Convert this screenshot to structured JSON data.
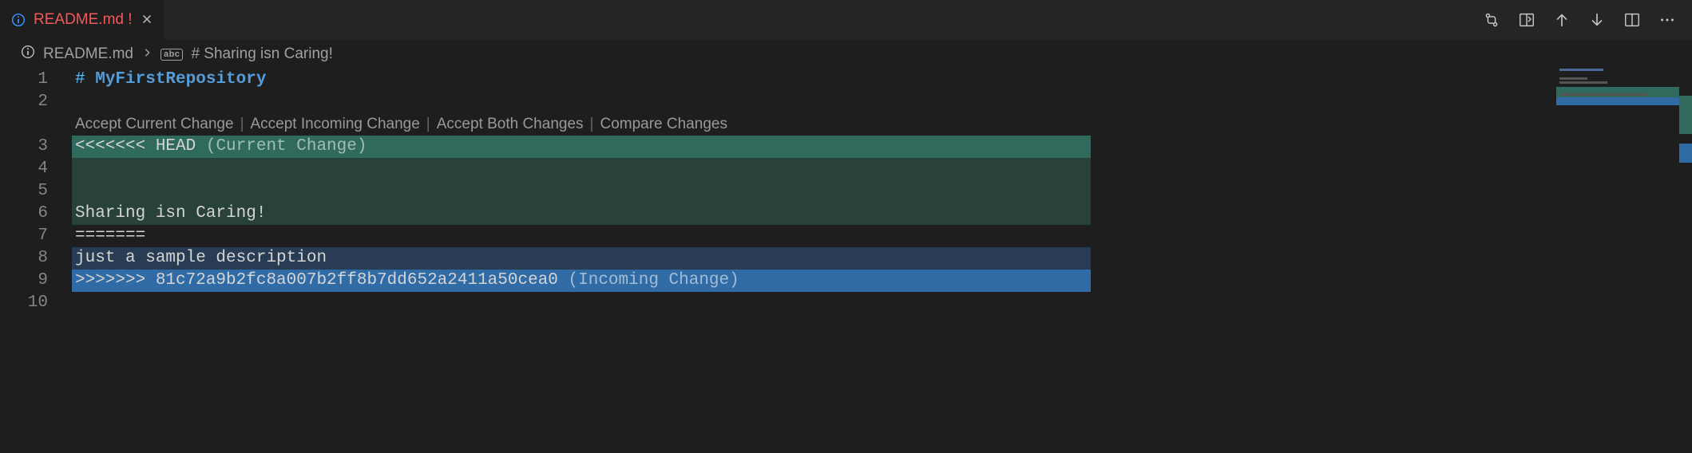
{
  "tab": {
    "filename": "README.md",
    "modified_mark": "!"
  },
  "breadcrumb": {
    "file": "README.md",
    "symbol": "# Sharing isn Caring!"
  },
  "codelens": {
    "accept_current": "Accept Current Change",
    "accept_incoming": "Accept Incoming Change",
    "accept_both": "Accept Both Changes",
    "compare": "Compare Changes"
  },
  "lines": {
    "n1": "1",
    "n2": "2",
    "n3": "3",
    "n4": "4",
    "n5": "5",
    "n6": "6",
    "n7": "7",
    "n8": "8",
    "n9": "9",
    "n10": "10"
  },
  "content": {
    "hash": "# ",
    "title": "MyFirstRepository",
    "head_marker": "<<<<<<< HEAD",
    "head_annot": " (Current Change)",
    "sharing": "Sharing isn Caring!",
    "sep": "=======",
    "sample": "just a sample description",
    "in_marker": ">>>>>>> 81c72a9b2fc8a007b2ff8b7dd652a2411a50cea0",
    "in_annot": " (Incoming Change)"
  }
}
